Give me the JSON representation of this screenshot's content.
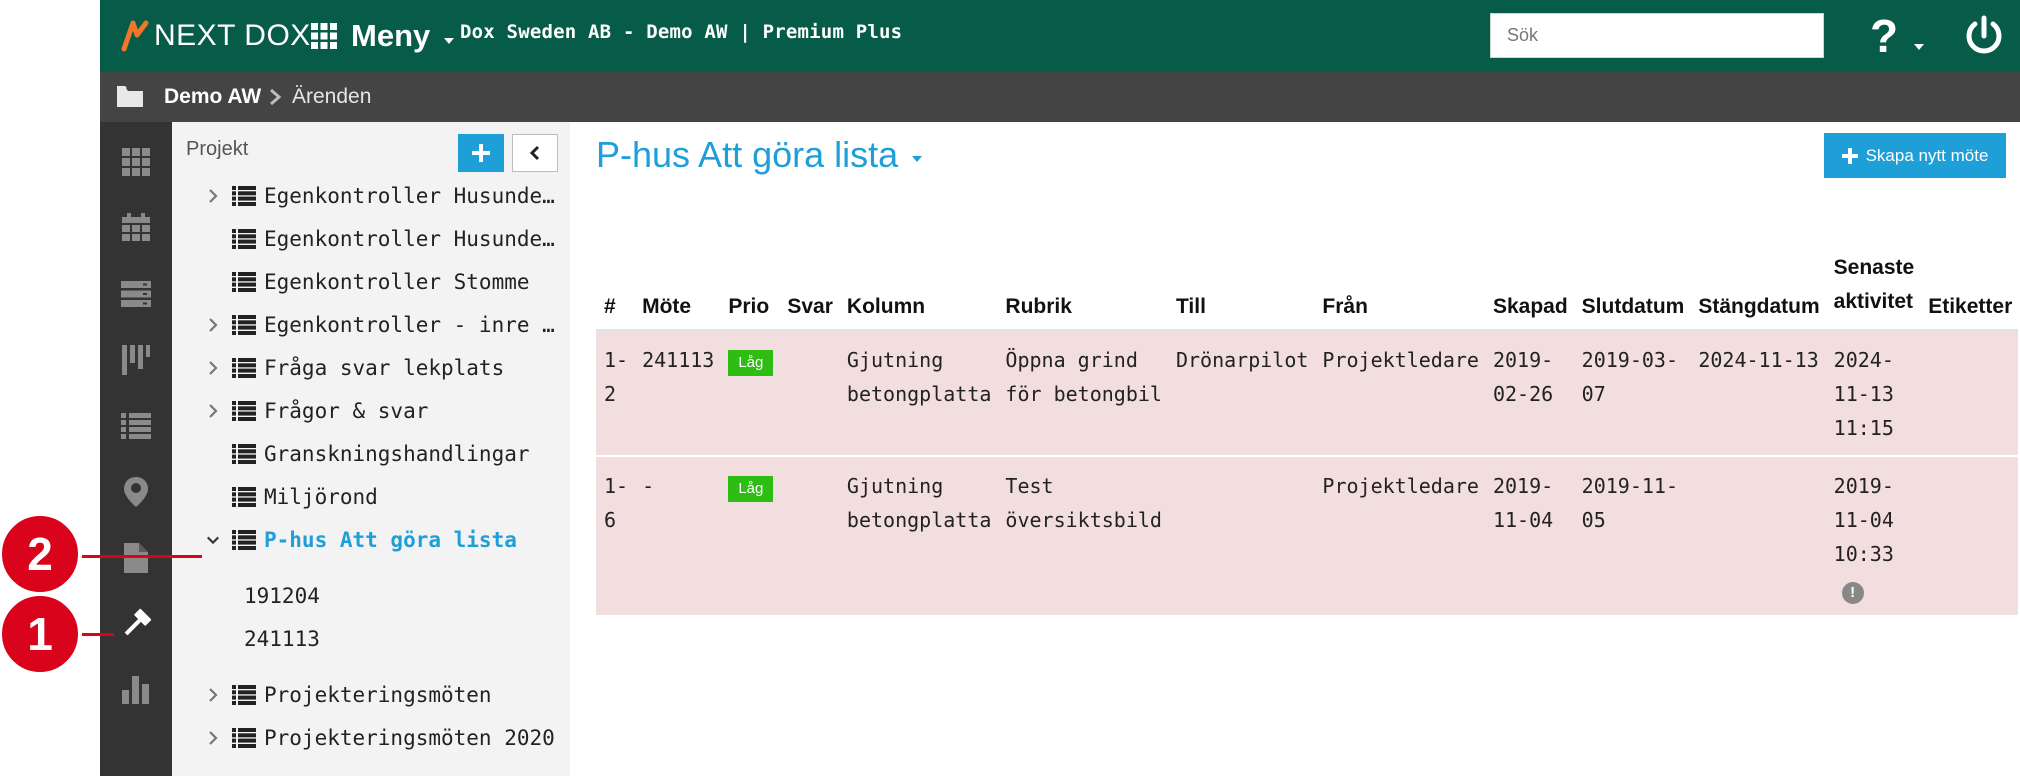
{
  "header": {
    "logo_text": "NEXT DOX",
    "menu_label": "Meny",
    "company": "Dox Sweden AB - Demo AW | Premium Plus",
    "search_placeholder": "Sök",
    "help_label": "?"
  },
  "breadcrumb": {
    "project": "Demo AW",
    "page": "Ärenden"
  },
  "rail": {
    "icons": [
      "apps-grid-icon",
      "calendar-icon",
      "server-icon",
      "board-icon",
      "list-icon",
      "map-pin-icon",
      "document-icon",
      "gavel-icon",
      "bar-chart-icon"
    ],
    "active_icon": "gavel-icon"
  },
  "tree": {
    "heading": "Projekt",
    "add_label": "+",
    "items": [
      {
        "label": "Egenkontroller Husunderbyggnad",
        "expandable": true
      },
      {
        "label": "Egenkontroller Husunderbyggnad",
        "expandable": false
      },
      {
        "label": "Egenkontroller Stomme",
        "expandable": false
      },
      {
        "label": "Egenkontroller - inre beklädnad",
        "expandable": true
      },
      {
        "label": "Fråga svar lekplats",
        "expandable": true
      },
      {
        "label": "Frågor & svar",
        "expandable": true
      },
      {
        "label": "Granskningshandlingar",
        "expandable": false
      },
      {
        "label": "Miljörond",
        "expandable": false
      },
      {
        "label": "P-hus Att göra lista",
        "expandable": true,
        "expanded": true,
        "active": true
      },
      {
        "label": "Projekteringsmöten",
        "expandable": true
      },
      {
        "label": "Projekteringsmöten 2020",
        "expandable": true
      }
    ],
    "subitems": [
      "191204",
      "241113"
    ]
  },
  "markers": {
    "one": "1",
    "two": "2"
  },
  "main": {
    "title": "P-hus Att göra lista",
    "new_meeting_label": "Skapa nytt möte",
    "columns": [
      "#",
      "Möte",
      "Prio",
      "Svar",
      "Kolumn",
      "Rubrik",
      "Till",
      "Från",
      "Skapad",
      "Slutdatum",
      "Stängdatum",
      "Senaste aktivitet",
      "Etiketter"
    ],
    "rows": [
      {
        "num": "1-2",
        "mote": "241113",
        "prio": "Låg",
        "svar": "",
        "kolumn": "Gjutning betongplatta",
        "rubrik": "Öppna grind för betongbil",
        "till": "Drönarpilot",
        "fran": "Projektledare",
        "skapad": "2019-02-26",
        "slutdatum": "2019-03-07",
        "stangdatum": "2024-11-13",
        "senaste": "2024-11-13 11:15",
        "etiketter": ""
      },
      {
        "num": "1-6",
        "mote": "-",
        "prio": "Låg",
        "svar": "",
        "kolumn": "Gjutning betongplatta",
        "rubrik": "Test översiktsbild",
        "till": "",
        "fran": "Projektledare",
        "skapad": "2019-11-04",
        "slutdatum": "2019-11-05",
        "stangdatum": "",
        "senaste": "2019-11-04 10:33",
        "etiketter": ""
      }
    ],
    "info_glyph": "!"
  },
  "colors": {
    "header_green": "#075c49",
    "accent_blue": "#1e9fd8",
    "row_pink": "#f2dede",
    "badge_green": "#2ebd12",
    "marker_red": "#d9041c"
  }
}
